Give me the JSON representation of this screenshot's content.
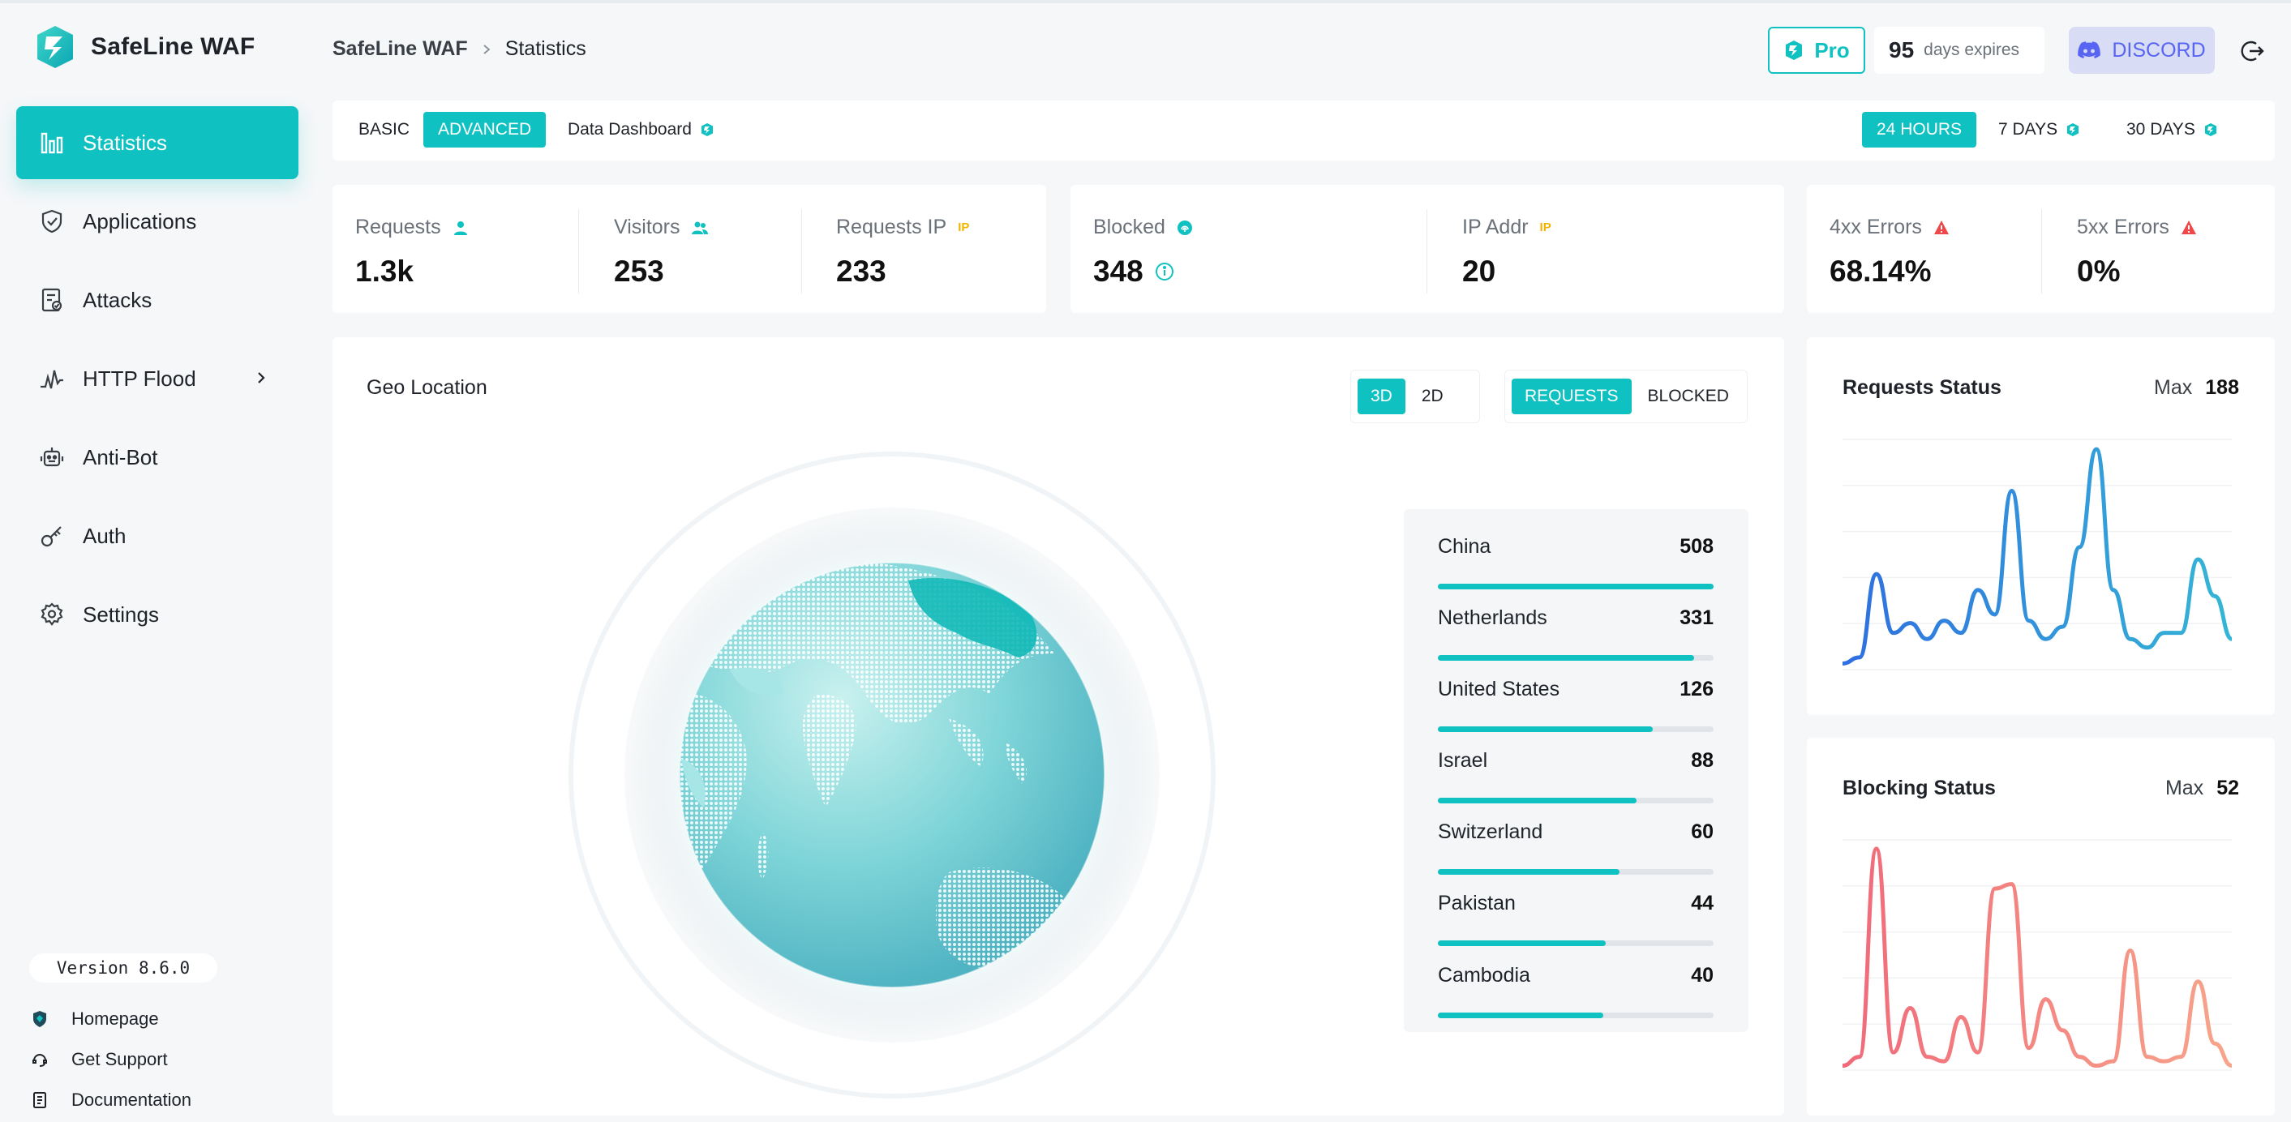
{
  "app": {
    "name": "SafeLine WAF"
  },
  "breadcrumb": {
    "root": "SafeLine WAF",
    "current": "Statistics"
  },
  "header": {
    "pro_label": "Pro",
    "days_count": "95",
    "days_label": "days expires",
    "discord_label": "DISCORD"
  },
  "sidebar": {
    "items": [
      {
        "label": "Statistics",
        "icon": "bar-chart-icon",
        "active": true
      },
      {
        "label": "Applications",
        "icon": "shield-icon"
      },
      {
        "label": "Attacks",
        "icon": "document-check-icon"
      },
      {
        "label": "HTTP Flood",
        "icon": "pulse-icon",
        "has_submenu": true
      },
      {
        "label": "Anti-Bot",
        "icon": "robot-icon"
      },
      {
        "label": "Auth",
        "icon": "key-icon"
      },
      {
        "label": "Settings",
        "icon": "gear-icon"
      }
    ],
    "version": "Version 8.6.0",
    "footer_links": [
      {
        "label": "Homepage",
        "icon": "shield-filled-icon"
      },
      {
        "label": "Get Support",
        "icon": "support-icon"
      },
      {
        "label": "Documentation",
        "icon": "doc-icon"
      }
    ]
  },
  "tabs": {
    "left": [
      "BASIC",
      "ADVANCED",
      "Data Dashboard"
    ],
    "left_active": "ADVANCED",
    "range": [
      "24 HOURS",
      "7 DAYS",
      "30 DAYS"
    ],
    "range_active": "24 HOURS"
  },
  "stats": {
    "requests": {
      "label": "Requests",
      "value": "1.3k"
    },
    "visitors": {
      "label": "Visitors",
      "value": "253"
    },
    "requests_ip": {
      "label": "Requests IP",
      "badge": "IP",
      "value": "233"
    },
    "blocked": {
      "label": "Blocked",
      "value": "348"
    },
    "ip_addr": {
      "label": "IP Addr",
      "badge": "IP",
      "value": "20"
    },
    "errors_4xx": {
      "label": "4xx Errors",
      "value": "68.14%"
    },
    "errors_5xx": {
      "label": "5xx Errors",
      "value": "0%"
    }
  },
  "geo": {
    "title": "Geo Location",
    "view_modes": [
      "3D",
      "2D"
    ],
    "view_active": "3D",
    "metric_modes": [
      "REQUESTS",
      "BLOCKED"
    ],
    "metric_active": "REQUESTS",
    "countries": [
      {
        "name": "China",
        "value": 508
      },
      {
        "name": "Netherlands",
        "value": 331
      },
      {
        "name": "United States",
        "value": 126
      },
      {
        "name": "Israel",
        "value": 88
      },
      {
        "name": "Switzerland",
        "value": 60
      },
      {
        "name": "Pakistan",
        "value": 44
      },
      {
        "name": "Cambodia",
        "value": 40
      }
    ],
    "bar_fill_fractions": [
      1.0,
      0.93,
      0.78,
      0.72,
      0.66,
      0.61,
      0.6
    ]
  },
  "requests_status": {
    "title": "Requests Status",
    "max_label": "Max",
    "max_value": "188",
    "color_start": "#2f6fe0",
    "color_end": "#35b6d6"
  },
  "blocking_status": {
    "title": "Blocking Status",
    "max_label": "Max",
    "max_value": "52",
    "color_start": "#f06a7a",
    "color_end": "#f7a58a"
  },
  "colors": {
    "accent": "#10c1c1",
    "discord": "#5865f2",
    "warn": "#f04848",
    "ip_badge": "#f0b400"
  },
  "chart_data": [
    {
      "type": "line",
      "title": "Requests Status",
      "x": [
        0,
        1,
        2,
        3,
        4,
        5,
        6,
        7,
        8,
        9,
        10,
        11,
        12,
        13,
        14,
        15,
        16,
        17,
        18,
        19,
        20,
        21,
        22,
        23
      ],
      "values": [
        5,
        10,
        78,
        30,
        38,
        25,
        40,
        30,
        65,
        45,
        146,
        40,
        25,
        35,
        100,
        180,
        65,
        25,
        18,
        30,
        30,
        90,
        60,
        25
      ],
      "ylim": [
        0,
        188
      ]
    },
    {
      "type": "line",
      "title": "Blocking Status",
      "x": [
        0,
        1,
        2,
        3,
        4,
        5,
        6,
        7,
        8,
        9,
        10,
        11,
        12,
        13,
        14,
        15,
        16,
        17,
        18,
        19,
        20,
        21,
        22,
        23
      ],
      "values": [
        1,
        3,
        50,
        4,
        14,
        3,
        2,
        12,
        4,
        41,
        42,
        5,
        16,
        9,
        3,
        1,
        2,
        27,
        3,
        2,
        3,
        20,
        6,
        1
      ],
      "ylim": [
        0,
        52
      ]
    }
  ]
}
